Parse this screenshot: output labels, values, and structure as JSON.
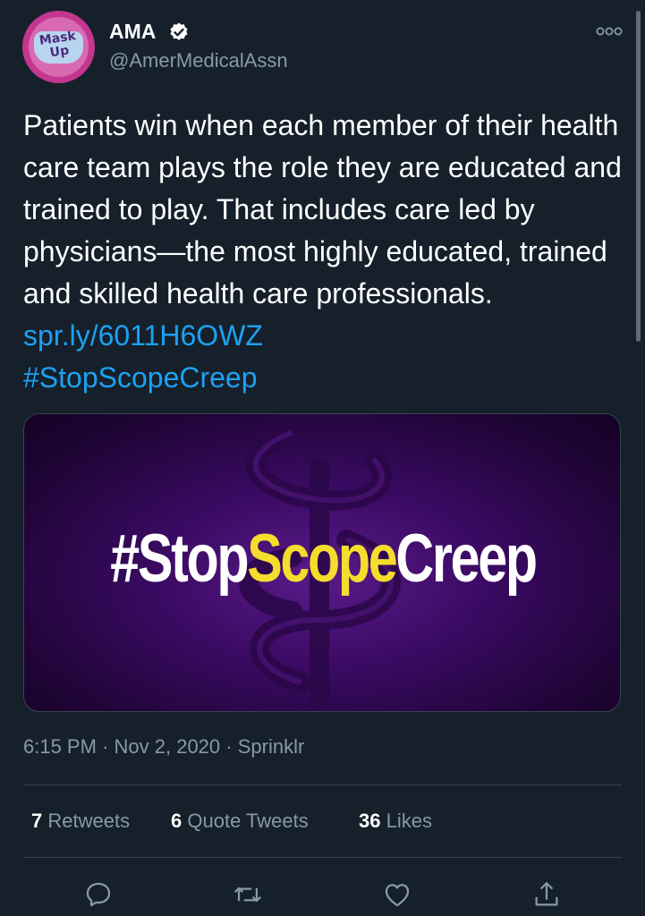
{
  "account": {
    "avatar_text_line1": "Mask",
    "avatar_text_line2": "Up",
    "display_name": "AMA",
    "handle": "@AmerMedicalAssn",
    "verified_icon": "verified-badge-icon"
  },
  "tweet": {
    "text": "Patients win when each member of their health care team plays the role they are educated and trained to play. That includes care led by physicians—the most highly educated, trained and skilled health care professionals. ",
    "link": "spr.ly/6011H6OWZ",
    "hashtag": "#StopScopeCreep",
    "image_text_part1": "#Stop",
    "image_text_part2": "Scope",
    "image_text_part3": "Creep",
    "time": "6:15 PM",
    "date": "Nov 2, 2020",
    "source": "Sprinklr",
    "separator": "·"
  },
  "stats": {
    "retweets_count": "7",
    "retweets_label": "Retweets",
    "quotes_count": "6",
    "quotes_label": "Quote Tweets",
    "likes_count": "36",
    "likes_label": "Likes"
  },
  "actions": [
    "reply-icon",
    "retweet-icon",
    "like-icon",
    "share-icon"
  ],
  "colors": {
    "background": "#15202b",
    "link": "#1da1f2",
    "muted": "#8899a6",
    "image_accent": "#f5dd2e"
  }
}
